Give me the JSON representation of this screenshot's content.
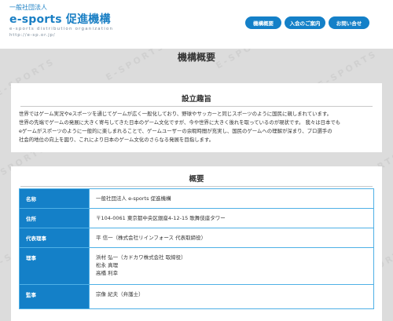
{
  "header": {
    "org_type": "一般社団法人",
    "title": "e-sports 促進機構",
    "subtitle": "e-sports distribution organization",
    "url": "http://e-sp.or.jp/"
  },
  "nav": {
    "items": [
      {
        "label": "機構概要"
      },
      {
        "label": "入会のご案内"
      },
      {
        "label": "お問い合せ"
      }
    ]
  },
  "page": {
    "title": "機構概要",
    "watermark_text": "E-SPORTS"
  },
  "purpose": {
    "title": "設立趣旨",
    "lines": [
      "世界ではゲーム実況やeスポーツを通じてゲームが広く一般化しており、野球やサッカーと同じスポーツのように国民に親しまれています。",
      "世界の先端でゲームの発展に大きく寄与してきた日本のゲーム文化ですが、今や世界に大きく後れを取っているのが現状です。 我々は日本でも",
      "eゲームがスポーツのように一般的に楽しまれることで、ゲームユーザーの余暇時間が充実し、国民のゲームへの理解が深まり、プロ選手の",
      "社会的地位の向上を図り、これにより日本のゲーム文化のさらなる発展を目指します。"
    ]
  },
  "overview": {
    "title": "概要",
    "rows": [
      {
        "label": "名称",
        "value": "一般社団法人 e-sports 促進機構"
      },
      {
        "label": "住所",
        "value": "〒104-0061 東京都中央区銀座4-12-15 歌舞伎座タワー"
      },
      {
        "label": "代表理事",
        "value": "平 信一（株式会社リインフォース 代表取締役）"
      },
      {
        "label": "理事",
        "values": [
          "浜村 弘一（カドカワ株式会社 取締役）",
          "松永 真理",
          "高橋 利幸"
        ]
      },
      {
        "label": "監事",
        "value": "宗像 紀夫（弁護士）"
      }
    ]
  },
  "colors": {
    "brand": "#1a7fc4",
    "nav_bg": "#1480c8",
    "table_border": "#4fb0e6",
    "band_bg": "#dcdcdc"
  }
}
